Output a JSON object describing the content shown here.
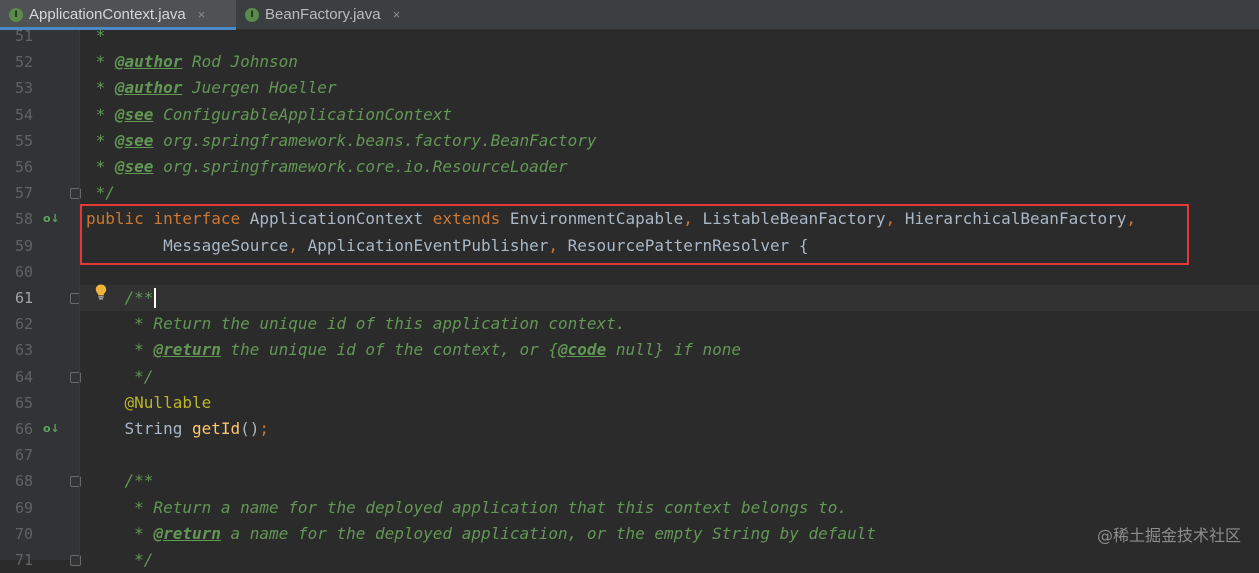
{
  "tabs": [
    {
      "label": "ApplicationContext.java",
      "icon": "interface-icon",
      "icon_letter": "I",
      "active": true
    },
    {
      "label": "BeanFactory.java",
      "icon": "interface-icon",
      "icon_letter": "I",
      "active": false
    }
  ],
  "tab_close_glyph": "×",
  "current_line": "61",
  "lines": [
    {
      "num": "51",
      "segments": [
        {
          "t": " *",
          "c": "c-doc"
        }
      ]
    },
    {
      "num": "52",
      "segments": [
        {
          "t": " * ",
          "c": "c-doc"
        },
        {
          "t": "@author",
          "c": "c-tag"
        },
        {
          "t": " Rod Johnson",
          "c": "c-doc"
        }
      ]
    },
    {
      "num": "53",
      "segments": [
        {
          "t": " * ",
          "c": "c-doc"
        },
        {
          "t": "@author",
          "c": "c-tag"
        },
        {
          "t": " Juergen Hoeller",
          "c": "c-doc"
        }
      ]
    },
    {
      "num": "54",
      "segments": [
        {
          "t": " * ",
          "c": "c-doc"
        },
        {
          "t": "@see",
          "c": "c-tag"
        },
        {
          "t": " ConfigurableApplicationContext",
          "c": "c-doc"
        }
      ]
    },
    {
      "num": "55",
      "segments": [
        {
          "t": " * ",
          "c": "c-doc"
        },
        {
          "t": "@see",
          "c": "c-tag"
        },
        {
          "t": " org.springframework.beans.factory.BeanFactory",
          "c": "c-doc"
        }
      ]
    },
    {
      "num": "56",
      "segments": [
        {
          "t": " * ",
          "c": "c-doc"
        },
        {
          "t": "@see",
          "c": "c-tag"
        },
        {
          "t": " org.springframework.core.io.ResourceLoader",
          "c": "c-doc"
        }
      ]
    },
    {
      "num": "57",
      "segments": [
        {
          "t": " */",
          "c": "c-doc"
        }
      ]
    },
    {
      "num": "58",
      "segments": [
        {
          "t": "public interface ",
          "c": "kw"
        },
        {
          "t": "ApplicationContext ",
          "c": "plain"
        },
        {
          "t": "extends ",
          "c": "kw"
        },
        {
          "t": "EnvironmentCapable",
          "c": "plain"
        },
        {
          "t": ", ",
          "c": "kw"
        },
        {
          "t": "ListableBeanFactory",
          "c": "plain"
        },
        {
          "t": ", ",
          "c": "kw"
        },
        {
          "t": "HierarchicalBeanFactory",
          "c": "plain"
        },
        {
          "t": ",",
          "c": "kw"
        }
      ]
    },
    {
      "num": "59",
      "segments": [
        {
          "t": "        MessageSource",
          "c": "plain"
        },
        {
          "t": ", ",
          "c": "kw"
        },
        {
          "t": "ApplicationEventPublisher",
          "c": "plain"
        },
        {
          "t": ", ",
          "c": "kw"
        },
        {
          "t": "ResourcePatternResolver {",
          "c": "plain"
        }
      ]
    },
    {
      "num": "60",
      "segments": []
    },
    {
      "num": "61",
      "segments": [
        {
          "t": "    /**",
          "c": "c-doc"
        }
      ]
    },
    {
      "num": "62",
      "segments": [
        {
          "t": "     * Return the unique id of this application context.",
          "c": "c-doc"
        }
      ]
    },
    {
      "num": "63",
      "segments": [
        {
          "t": "     * ",
          "c": "c-doc"
        },
        {
          "t": "@return",
          "c": "c-tag"
        },
        {
          "t": " the unique id of the context, or {",
          "c": "c-doc"
        },
        {
          "t": "@code",
          "c": "c-tag"
        },
        {
          "t": " null} if none",
          "c": "c-doc"
        }
      ]
    },
    {
      "num": "64",
      "segments": [
        {
          "t": "     */",
          "c": "c-doc"
        }
      ]
    },
    {
      "num": "65",
      "segments": [
        {
          "t": "    @Nullable",
          "c": "ann"
        }
      ]
    },
    {
      "num": "66",
      "segments": [
        {
          "t": "    String ",
          "c": "plain"
        },
        {
          "t": "getId",
          "c": "method"
        },
        {
          "t": "()",
          "c": "plain"
        },
        {
          "t": ";",
          "c": "kw"
        }
      ]
    },
    {
      "num": "67",
      "segments": []
    },
    {
      "num": "68",
      "segments": [
        {
          "t": "    /**",
          "c": "c-doc"
        }
      ]
    },
    {
      "num": "69",
      "segments": [
        {
          "t": "     * Return a name for the deployed application that this context belongs to.",
          "c": "c-doc"
        }
      ]
    },
    {
      "num": "70",
      "segments": [
        {
          "t": "     * ",
          "c": "c-doc"
        },
        {
          "t": "@return",
          "c": "c-tag"
        },
        {
          "t": " a name for the deployed application, or the empty String by default",
          "c": "c-doc"
        }
      ]
    },
    {
      "num": "71",
      "segments": [
        {
          "t": "     */",
          "c": "c-doc"
        }
      ]
    }
  ],
  "gutter_markers": {
    "implemented": [
      "58",
      "66"
    ],
    "implemented_glyph": "o↓",
    "fold": [
      "57",
      "61",
      "64",
      "68",
      "71"
    ],
    "intention_bulb_line": "61"
  },
  "highlighted_lines": [
    "58",
    "59"
  ],
  "watermark": "@稀土掘金技术社区"
}
